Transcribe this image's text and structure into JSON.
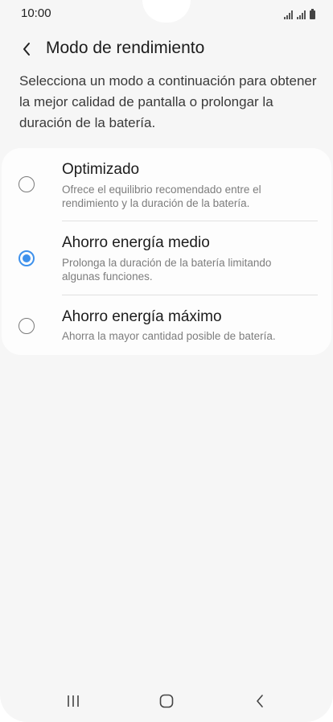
{
  "status_bar": {
    "time": "10:00"
  },
  "header": {
    "back_icon": "chevron-left-icon",
    "title": "Modo de rendimiento"
  },
  "description": "Selecciona un modo a continuación para obtener la mejor calidad de pantalla o prolongar la duración de la batería.",
  "options": [
    {
      "title": "Optimizado",
      "description": "Ofrece el equilibrio recomendado entre el rendimiento y la duración de la batería.",
      "selected": false
    },
    {
      "title": "Ahorro energía medio",
      "description": "Prolonga la duración de la batería limitando algunas funciones.",
      "selected": true
    },
    {
      "title": "Ahorro energía máximo",
      "description": "Ahorra la mayor cantidad posible de batería.",
      "selected": false
    }
  ],
  "nav_bar": {
    "recents_icon": "recents-icon",
    "home_icon": "home-icon",
    "back_icon": "back-icon"
  },
  "colors": {
    "accent": "#3e91ec",
    "background": "#f6f6f6",
    "card": "#fdfdfd"
  }
}
